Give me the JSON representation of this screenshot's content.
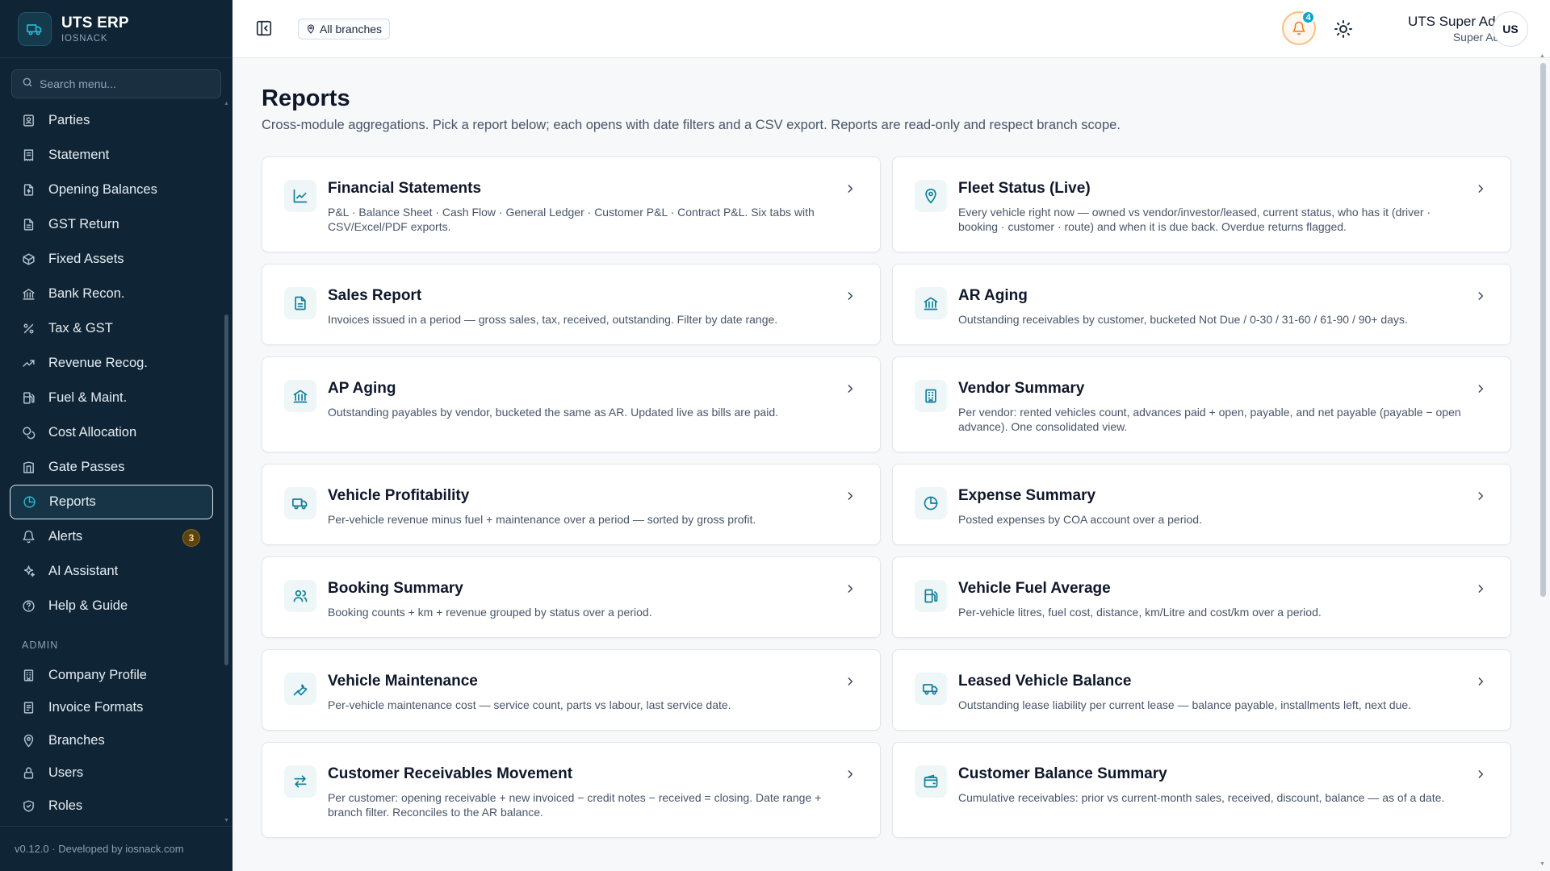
{
  "brand": {
    "name": "UTS ERP",
    "sub": "IOSNACK"
  },
  "search": {
    "placeholder": "Search menu..."
  },
  "nav": [
    {
      "label": "Parties",
      "icon": "contact-book-icon"
    },
    {
      "label": "Statement",
      "icon": "receipt-icon"
    },
    {
      "label": "Opening Balances",
      "icon": "document-dollar-icon"
    },
    {
      "label": "GST Return",
      "icon": "file-text-icon"
    },
    {
      "label": "Fixed Assets",
      "icon": "box-icon"
    },
    {
      "label": "Bank Recon.",
      "icon": "bank-icon"
    },
    {
      "label": "Tax & GST",
      "icon": "percent-icon"
    },
    {
      "label": "Revenue Recog.",
      "icon": "trend-up-icon"
    },
    {
      "label": "Fuel & Maint.",
      "icon": "fuel-icon"
    },
    {
      "label": "Cost Allocation",
      "icon": "coins-icon"
    },
    {
      "label": "Gate Passes",
      "icon": "gate-icon"
    },
    {
      "label": "Reports",
      "icon": "pie-chart-icon",
      "active": true
    },
    {
      "label": "Alerts",
      "icon": "bell-icon",
      "badge": "3"
    },
    {
      "label": "AI Assistant",
      "icon": "sparkles-icon"
    },
    {
      "label": "Help & Guide",
      "icon": "help-circle-icon"
    }
  ],
  "admin": {
    "label": "ADMIN",
    "items": [
      {
        "label": "Company Profile",
        "icon": "building-icon"
      },
      {
        "label": "Invoice Formats",
        "icon": "invoice-icon"
      },
      {
        "label": "Branches",
        "icon": "map-pin-icon"
      },
      {
        "label": "Users",
        "icon": "lock-icon"
      },
      {
        "label": "Roles",
        "icon": "shield-check-icon"
      }
    ]
  },
  "footer": {
    "text": "v0.12.0 · Developed by iosnack.com"
  },
  "topbar": {
    "branch_label": "All branches",
    "notification_count": "4",
    "user_name": "UTS Super Admin",
    "user_role": "Super Admin",
    "avatar_initials": "US"
  },
  "page": {
    "title": "Reports",
    "subtitle": "Cross-module aggregations. Pick a report below; each opens with date filters and a CSV export. Reports are read-only and respect branch scope."
  },
  "reports": [
    {
      "title": "Financial Statements",
      "desc": "P&L · Balance Sheet · Cash Flow · General Ledger · Customer P&L · Contract P&L. Six tabs with CSV/Excel/PDF exports.",
      "icon": "line-chart-icon"
    },
    {
      "title": "Fleet Status (Live)",
      "desc": "Every vehicle right now — owned vs vendor/investor/leased, current status, who has it (driver · booking · customer · route) and when it is due back. Overdue returns flagged.",
      "icon": "location-pin-icon"
    },
    {
      "title": "Sales Report",
      "desc": "Invoices issued in a period — gross sales, tax, received, outstanding. Filter by date range.",
      "icon": "document-icon"
    },
    {
      "title": "AR Aging",
      "desc": "Outstanding receivables by customer, bucketed Not Due / 0-30 / 31-60 / 61-90 / 90+ days.",
      "icon": "bank-icon"
    },
    {
      "title": "AP Aging",
      "desc": "Outstanding payables by vendor, bucketed the same as AR. Updated live as bills are paid.",
      "icon": "bank-icon"
    },
    {
      "title": "Vendor Summary",
      "desc": "Per vendor: rented vehicles count, advances paid + open, payable, and net payable (payable − open advance). One consolidated view.",
      "icon": "building-icon"
    },
    {
      "title": "Vehicle Profitability",
      "desc": "Per-vehicle revenue minus fuel + maintenance over a period — sorted by gross profit.",
      "icon": "truck-icon"
    },
    {
      "title": "Expense Summary",
      "desc": "Posted expenses by COA account over a period.",
      "icon": "pie-chart-icon"
    },
    {
      "title": "Booking Summary",
      "desc": "Booking counts + km + revenue grouped by status over a period.",
      "icon": "users-icon"
    },
    {
      "title": "Vehicle Fuel Average",
      "desc": "Per-vehicle litres, fuel cost, distance, km/Litre and cost/km over a period.",
      "icon": "fuel-icon"
    },
    {
      "title": "Vehicle Maintenance",
      "desc": "Per-vehicle maintenance cost — service count, parts vs labour, last service date.",
      "icon": "wrench-icon"
    },
    {
      "title": "Leased Vehicle Balance",
      "desc": "Outstanding lease liability per current lease — balance payable, installments left, next due.",
      "icon": "truck-icon"
    },
    {
      "title": "Customer Receivables Movement",
      "desc": "Per customer: opening receivable + new invoiced − credit notes − received = closing. Date range + branch filter. Reconciles to the AR balance.",
      "icon": "arrows-swap-icon"
    },
    {
      "title": "Customer Balance Summary",
      "desc": "Cumulative receivables: prior vs current-month sales, received, discount, balance — as of a date.",
      "icon": "wallet-icon"
    }
  ]
}
